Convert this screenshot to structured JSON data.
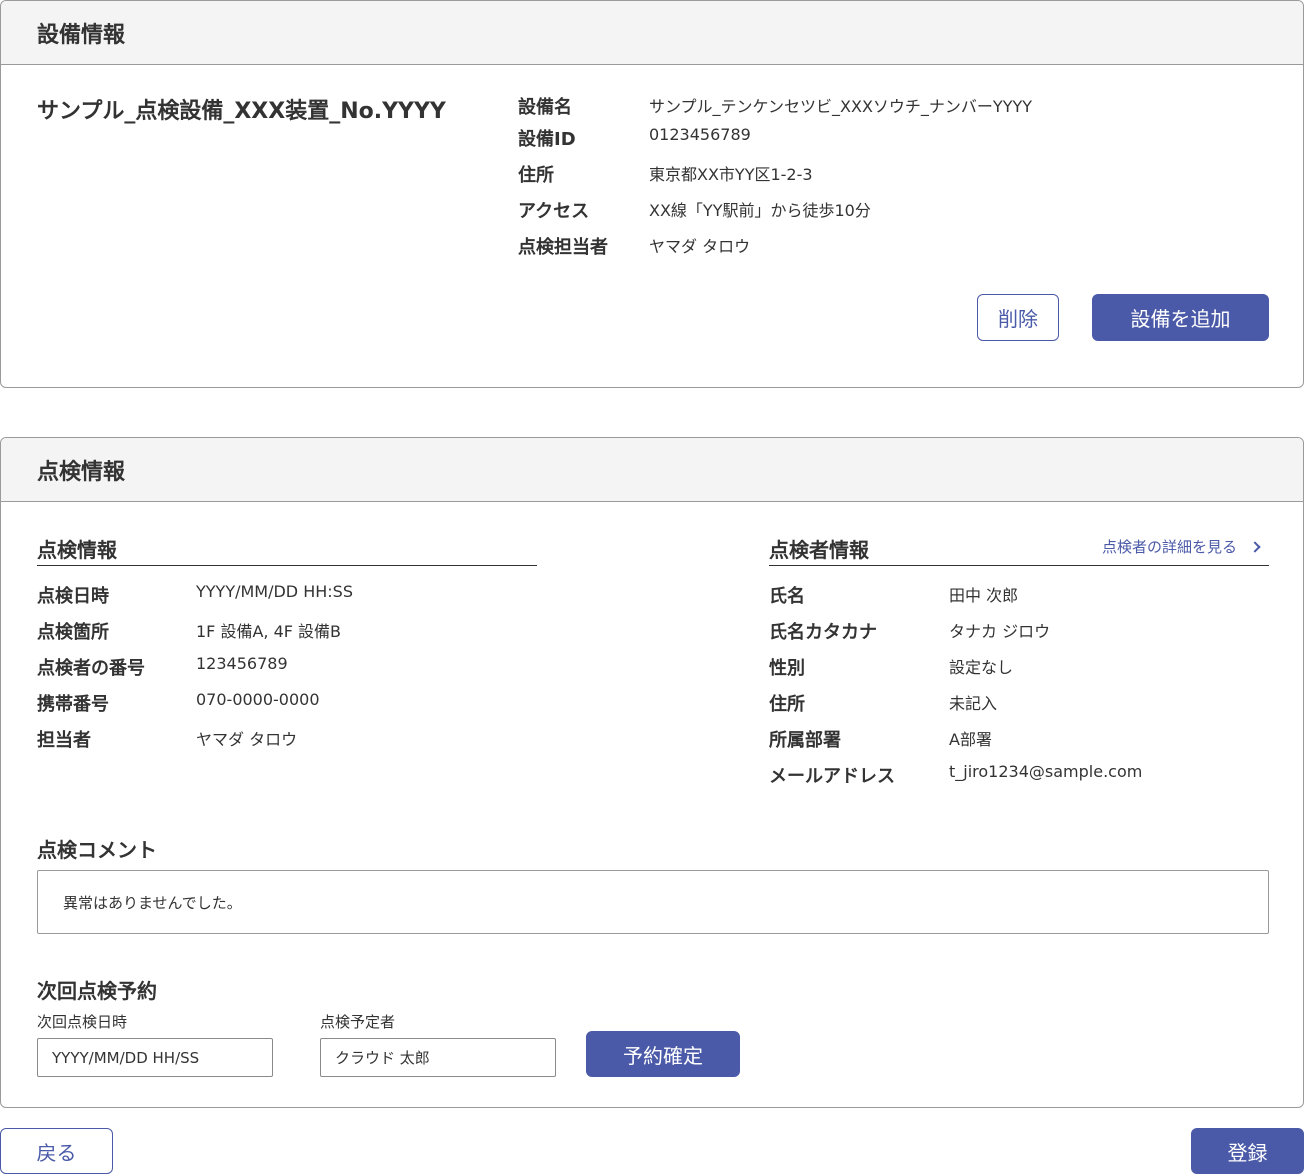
{
  "equipment": {
    "header": "設備情報",
    "title": "サンプル_点検設備_XXX装置_No.YYYY",
    "fields": [
      {
        "label": "設備名",
        "value": "サンプル_テンケンセツビ_XXXソウチ_ナンバーYYYY"
      },
      {
        "label": "設備ID",
        "value": "0123456789"
      },
      {
        "label": "住所",
        "value": "東京都XX市YY区1-2-3"
      },
      {
        "label": "アクセス",
        "value": "XX線「YY駅前」から徒歩10分"
      },
      {
        "label": "点検担当者",
        "value": "ヤマダ タロウ"
      }
    ],
    "delete_label": "削除",
    "add_label": "設備を追加"
  },
  "inspection": {
    "header": "点検情報",
    "info": {
      "title": "点検情報",
      "fields": [
        {
          "label": "点検日時",
          "value": "YYYY/MM/DD HH:SS"
        },
        {
          "label": "点検箇所",
          "value": "1F 設備A, 4F 設備B"
        },
        {
          "label": "点検者の番号",
          "value": "123456789"
        },
        {
          "label": "携帯番号",
          "value": "070-0000-0000"
        },
        {
          "label": "担当者",
          "value": "ヤマダ タロウ"
        }
      ]
    },
    "inspector": {
      "title": "点検者情報",
      "detail_link": "点検者の詳細を見る",
      "fields": [
        {
          "label": "氏名",
          "value": "田中 次郎"
        },
        {
          "label": "氏名カタカナ",
          "value": "タナカ ジロウ"
        },
        {
          "label": "性別",
          "value": "設定なし"
        },
        {
          "label": "住所",
          "value": "未記入"
        },
        {
          "label": "所属部署",
          "value": "A部署"
        },
        {
          "label": "メールアドレス",
          "value": "t_jiro1234@sample.com"
        }
      ]
    },
    "comment": {
      "title": "点検コメント",
      "text": "異常はありませんでした。"
    },
    "next": {
      "title": "次回点検予約",
      "date_label": "次回点検日時",
      "date_value": "YYYY/MM/DD HH/SS",
      "person_label": "点検予定者",
      "person_value": "クラウド 太郎",
      "confirm_label": "予約確定"
    }
  },
  "footer": {
    "back_label": "戻る",
    "register_label": "登録"
  },
  "colors": {
    "accent": "#4b5aa8",
    "text": "#333333",
    "border": "#9a9a9a",
    "header_bg": "#f4f4f4"
  }
}
